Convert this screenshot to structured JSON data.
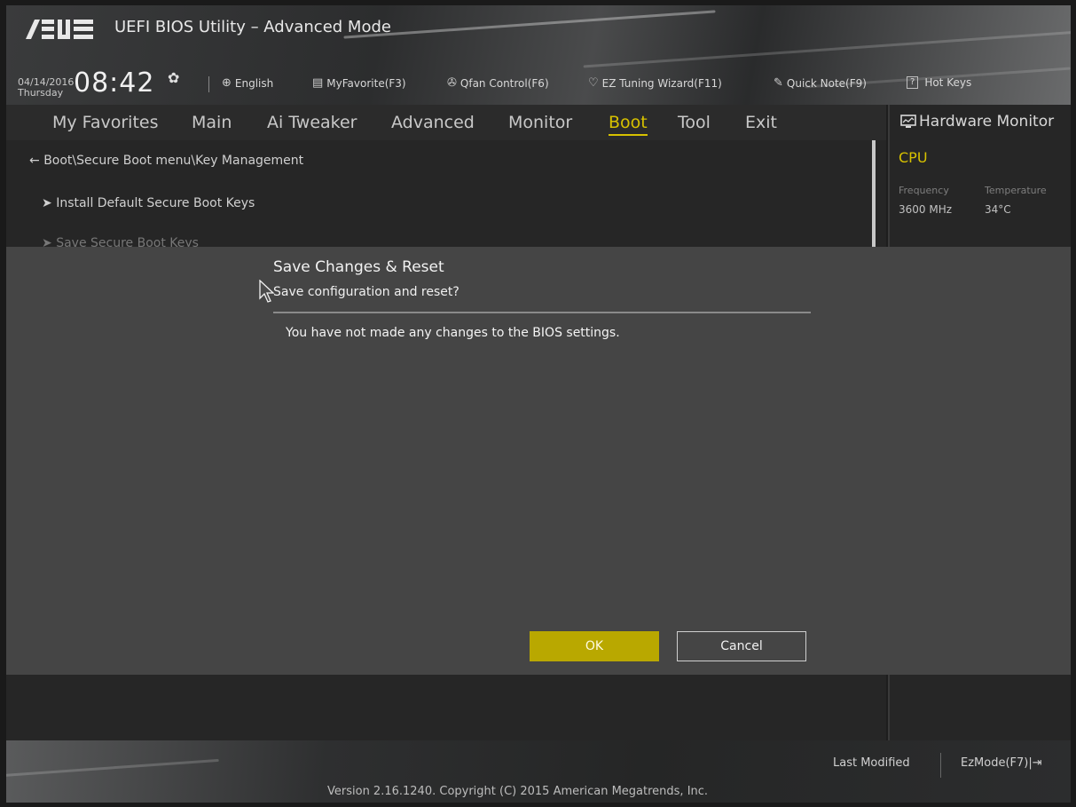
{
  "app": {
    "brand": "/ISUS",
    "title": "UEFI BIOS Utility – Advanced Mode"
  },
  "toolbar": {
    "date": "04/14/2016",
    "day": "Thursday",
    "time": "08:42",
    "items": [
      {
        "label": "English",
        "icon": "globe-icon"
      },
      {
        "label": "MyFavorite(F3)",
        "icon": "favorite-icon"
      },
      {
        "label": "Qfan Control(F6)",
        "icon": "fan-icon"
      },
      {
        "label": "EZ Tuning Wizard(F11)",
        "icon": "bulb-icon"
      },
      {
        "label": "Quick Note(F9)",
        "icon": "note-icon"
      },
      {
        "label": "Hot Keys",
        "icon": "help-icon",
        "key": "?"
      }
    ]
  },
  "tabs": [
    {
      "label": "My Favorites"
    },
    {
      "label": "Main"
    },
    {
      "label": "Ai Tweaker"
    },
    {
      "label": "Advanced"
    },
    {
      "label": "Monitor"
    },
    {
      "label": "Boot",
      "active": true
    },
    {
      "label": "Tool"
    },
    {
      "label": "Exit"
    }
  ],
  "content": {
    "breadcrumb": "Boot\\Secure Boot menu\\Key Management",
    "items": [
      "Install Default Secure Boot Keys",
      "Save Secure Boot Keys"
    ]
  },
  "hw_monitor": {
    "title": "Hardware Monitor",
    "section": "CPU",
    "frequency_label": "Frequency",
    "temperature_label": "Temperature",
    "frequency_value": "3600 MHz",
    "temperature_value": "34°C"
  },
  "dialog": {
    "title": "Save Changes & Reset",
    "subtitle": "Save configuration and reset?",
    "message": "You have not made any changes to the BIOS settings.",
    "ok_label": "OK",
    "cancel_label": "Cancel"
  },
  "footer": {
    "last_modified": "Last Modified",
    "ezmode": "EzMode(F7)",
    "version": "Version 2.16.1240. Copyright (C) 2015 American Megatrends, Inc."
  },
  "colors": {
    "accent": "#d7c100",
    "ok_button": "#b9a800",
    "overlay": "#454545"
  }
}
